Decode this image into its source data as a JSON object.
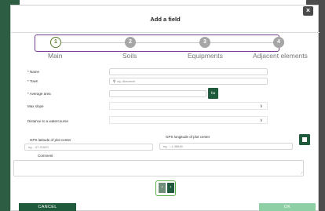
{
  "dialog": {
    "title": "Add a field",
    "close_icon": "close-icon"
  },
  "steps": [
    {
      "number": "1",
      "label": "Main",
      "active": true
    },
    {
      "number": "2",
      "label": "Soils",
      "active": false
    },
    {
      "number": "3",
      "label": "Equipments",
      "active": false
    },
    {
      "number": "4",
      "label": "Adjacent elements",
      "active": false
    }
  ],
  "form": {
    "name_label": "* Name",
    "name_value": "",
    "town_label": "* Town",
    "town_placeholder": "eg. Alacanch",
    "area_label": "* Average area",
    "area_value": "",
    "area_unit": "ha",
    "slope_label": "Max slope",
    "slope_value": "",
    "watercourse_label": "Distance to a watercourse",
    "watercourse_value": "",
    "lat_label": "GPS latitude of plot center",
    "lat_placeholder": "eg. : 47.21693",
    "lon_label": "GPS longitude of plot center",
    "lon_placeholder": "eg. : -1.46646",
    "map_icon": "map-icon",
    "comment_label": "Comment",
    "comment_value": ""
  },
  "navigation": {
    "prev_icon": "chevron-left-icon",
    "next_icon": "chevron-right-icon",
    "prev_glyph": "‹",
    "next_glyph": "›"
  },
  "footer": {
    "cancel_label": "CANCEL",
    "ok_label": "OK"
  },
  "colors": {
    "primary": "#1f5a3c",
    "active_step": "#5c7c2a",
    "steps_border": "#6f3a8a",
    "ok_disabled": "#8fcfa6",
    "inactive_step": "#a6a6a6"
  }
}
